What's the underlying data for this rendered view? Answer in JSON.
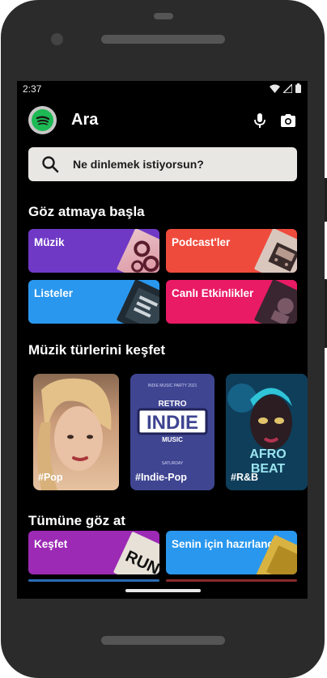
{
  "status_bar": {
    "time": "2:37"
  },
  "header": {
    "title": "Ara",
    "icons": [
      "spotify-logo",
      "microphone-icon",
      "camera-icon"
    ]
  },
  "search": {
    "placeholder": "Ne dinlemek istiyorsun?"
  },
  "sections": {
    "start_browsing": "Göz atmaya başla",
    "discover_genres": "Müzik türlerini keşfet",
    "browse_all": "Tümüne göz at"
  },
  "start_cards": [
    {
      "label": "Müzik",
      "color": "#6f39c6"
    },
    {
      "label": "Podcast'ler",
      "color": "#ef4b3c"
    },
    {
      "label": "Listeler",
      "color": "#2a97ee"
    },
    {
      "label": "Canlı Etkinlikler",
      "color": "#e91b64"
    }
  ],
  "genres": [
    {
      "label": "#Pop"
    },
    {
      "label": "#Indie-Pop",
      "art_lines": [
        "INDIE MUSIC PARTY 2021",
        "RETRO",
        "INDIE",
        "MUSIC",
        "SATURDAY"
      ]
    },
    {
      "label": "#R&B",
      "art_lines": [
        "AFRO",
        "BEAT"
      ]
    }
  ],
  "browse_cards": [
    {
      "label": "Keşfet",
      "color": "#9c2ab4",
      "art_text": "RUN"
    },
    {
      "label": "Senin için hazırlandı",
      "color": "#2a97ee"
    }
  ]
}
